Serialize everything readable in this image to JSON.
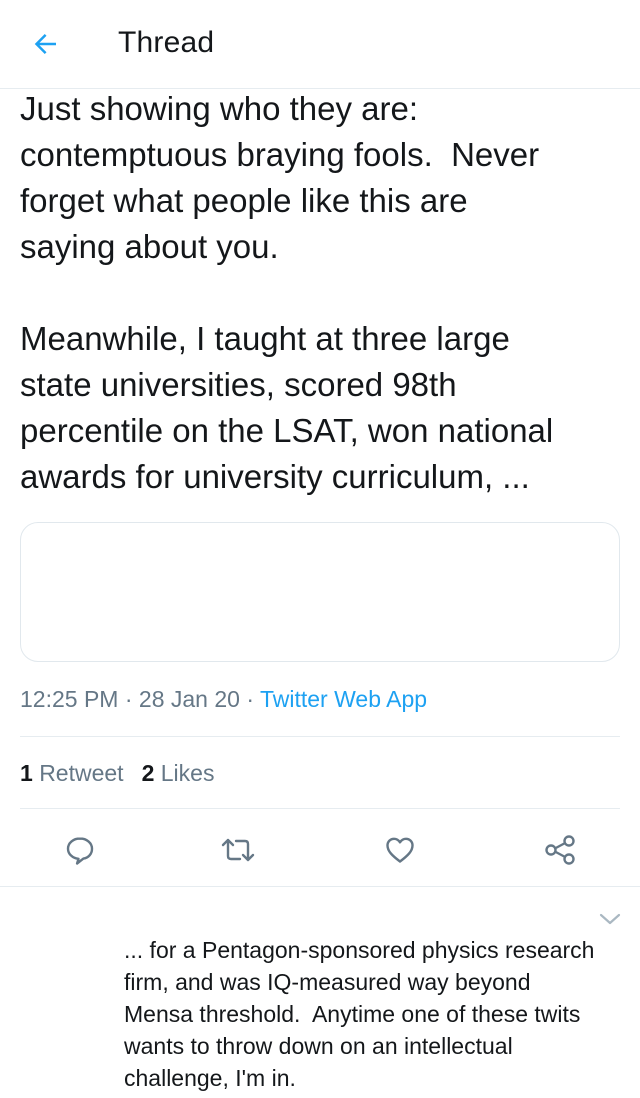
{
  "header": {
    "title": "Thread",
    "back_icon": "arrow-left-icon",
    "accent_color": "#1da1f2"
  },
  "tweet": {
    "text_paragraph_1": "Just showing who they are:\ncontemptuous braying fools.  Never\nforget what people like this are\nsaying about you.",
    "text_paragraph_2": "Meanwhile, I taught at three large\nstate universities, scored 98th\npercentile on the LSAT, won national\nawards for university curriculum, ...",
    "time": "12:25 PM",
    "separator": "·",
    "date": "28 Jan 20",
    "source": "Twitter Web App",
    "retweets_count": "1",
    "retweets_label": "Retweet",
    "likes_count": "2",
    "likes_label": "Likes"
  },
  "actions": [
    {
      "icon": "reply-icon"
    },
    {
      "icon": "retweet-icon"
    },
    {
      "icon": "heart-icon"
    },
    {
      "icon": "share-icon"
    }
  ],
  "reply": {
    "text": "... for a Pentagon-sponsored physics research\nfirm, and was IQ-measured way beyond\nMensa threshold.  Anytime one of these twits\nwants to throw down on an intellectual\nchallenge, I'm in.",
    "menu_icon": "chevron-down-icon"
  }
}
